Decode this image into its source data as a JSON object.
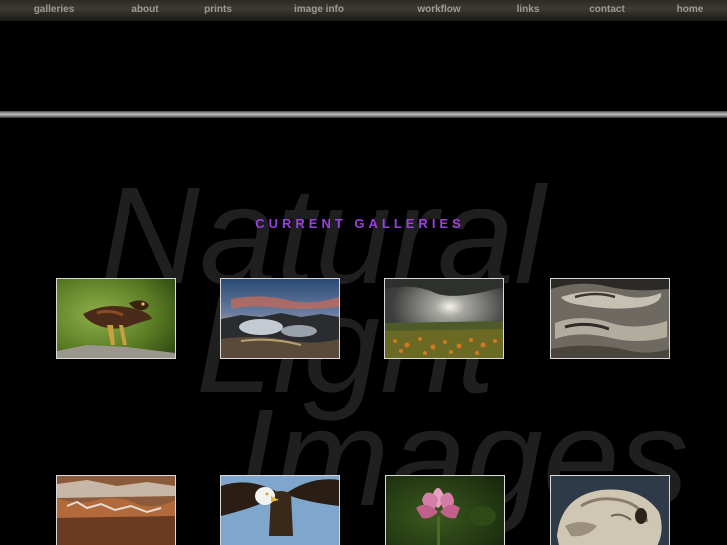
{
  "nav": {
    "items": [
      "galleries",
      "about",
      "prints",
      "image info",
      "workflow",
      "links",
      "contact",
      "home"
    ]
  },
  "watermark": {
    "lines": [
      "Natural",
      "Light",
      "Images"
    ]
  },
  "heading": "CURRENT GALLERIES",
  "colors": {
    "background": "#000000",
    "nav_text": "#9d9b95",
    "heading": "#9b3fe0",
    "thumb_border": "#d8d8d8",
    "watermark": "#1f1f1f"
  },
  "galleries": [
    {
      "icon": "hawk-photo"
    },
    {
      "icon": "geyser-sunset-photo"
    },
    {
      "icon": "meadow-storm-photo"
    },
    {
      "icon": "sand-ripples-photo"
    },
    {
      "icon": "canyon-photo"
    },
    {
      "icon": "bald-eagle-photo"
    },
    {
      "icon": "lotus-flower-photo"
    },
    {
      "icon": "otter-photo"
    }
  ]
}
